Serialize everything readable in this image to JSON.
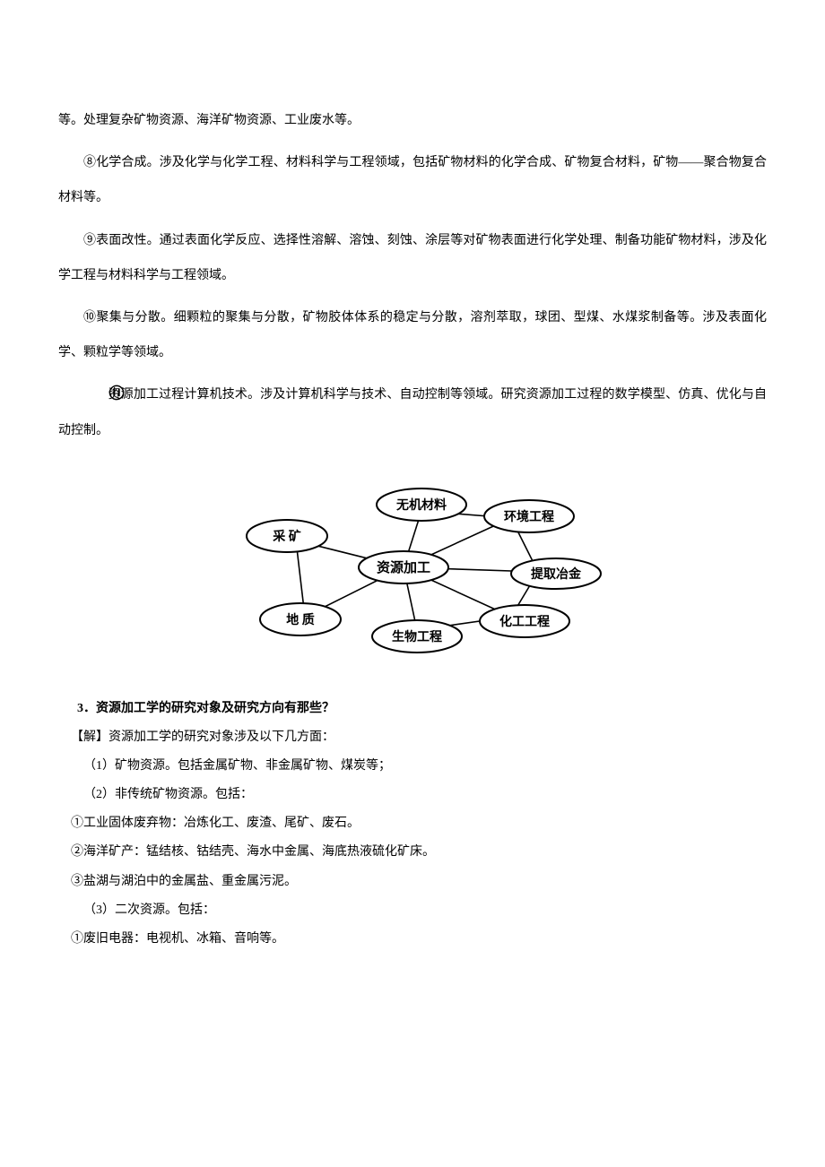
{
  "paragraphs": {
    "p0": "等。处理复杂矿物资源、海洋矿物资源、工业废水等。",
    "p8": "⑧化学合成。涉及化学与化学工程、材料科学与工程领域，包括矿物材料的化学合成、矿物复合材料，矿物——聚合物复合材料等。",
    "p9": "⑨表面改性。通过表面化学反应、选择性溶解、溶蚀、刻蚀、涂层等对矿物表面进行化学处理、制备功能矿物材料，涉及化学工程与材料科学与工程领域。",
    "p10": "⑩聚集与分散。细颗粒的聚集与分散，矿物胶体体系的稳定与分散，溶剂萃取，球团、型煤、水煤浆制备等。涉及表面化学、颗粒学等领域。",
    "p11": " 资源加工过程计算机技术。涉及计算机科学与技术、自动控制等领域。研究资源加工过程的数学模型、仿真、优化与自动控制。"
  },
  "diagram": {
    "center": "资源加工",
    "nodes": {
      "n1": "无机材料",
      "n2": "环境工程",
      "n3": "采 矿",
      "n4": "提取冶金",
      "n5": "地 质",
      "n6": "生物工程",
      "n7": "化工工程"
    }
  },
  "question": {
    "title": "3．资源加工学的研究对象及研究方向有那些？",
    "intro": "【解】资源加工学的研究对象涉及以下几方面：",
    "items": {
      "i1": "（1）矿物资源。包括金属矿物、非金属矿物、煤炭等；",
      "i2": "（2）非传统矿物资源。包括：",
      "i2a": "①工业固体废弃物：冶炼化工、废渣、尾矿、废石。",
      "i2b": "②海洋矿产：锰结核、钴结壳、海水中金属、海底热液硫化矿床。",
      "i2c": "③盐湖与湖泊中的金属盐、重金属污泥。",
      "i3": "（3）二次资源。包括：",
      "i3a": "①废旧电器：电视机、冰箱、音响等。"
    }
  }
}
